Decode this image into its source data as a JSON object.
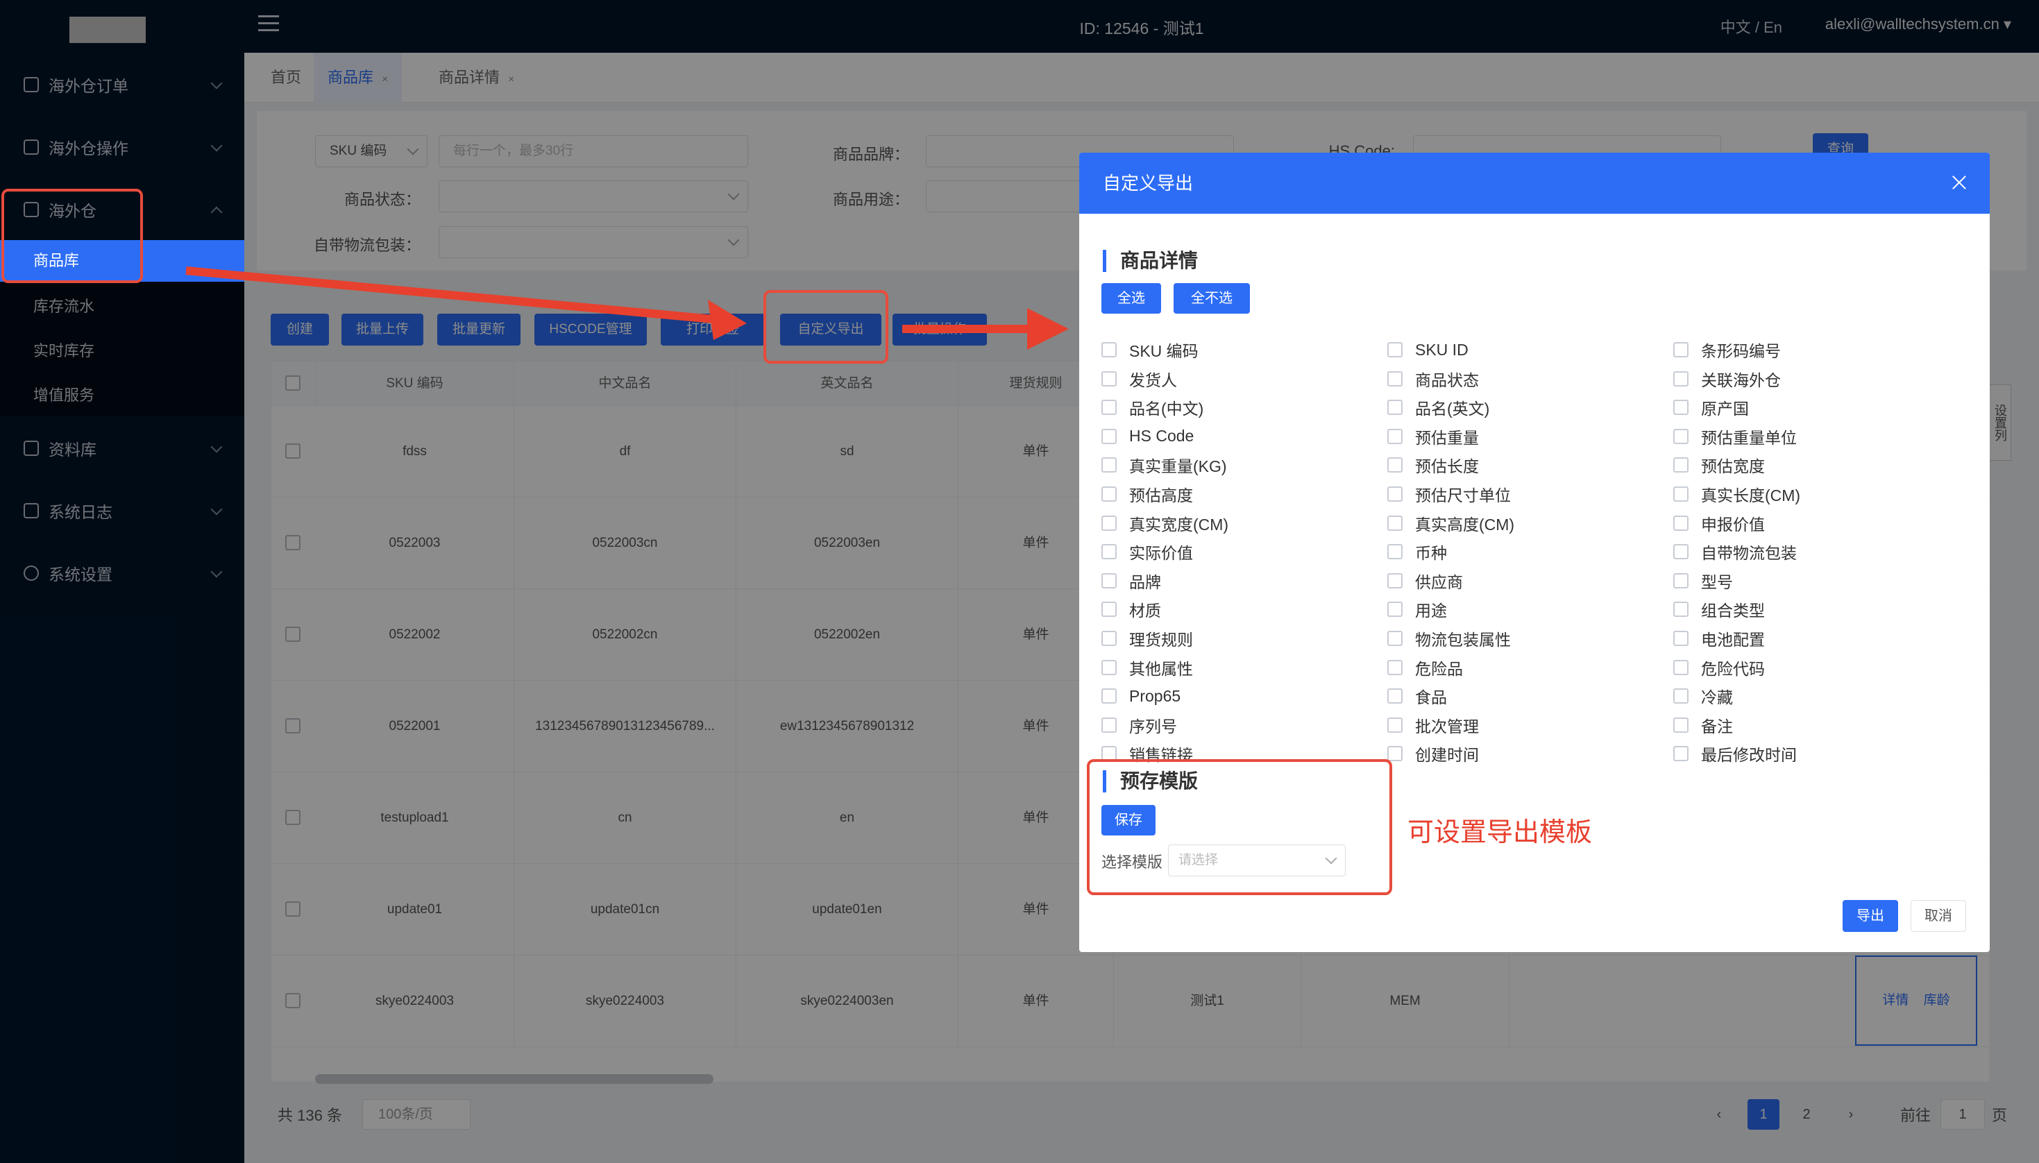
{
  "header": {
    "id_label": "ID: 12546 - 测试1",
    "lang": "中文 / En",
    "user": "alexli@walltechsystem.cn ▾"
  },
  "sidebar": {
    "items": [
      {
        "label": "海外仓订单"
      },
      {
        "label": "海外仓操作"
      },
      {
        "label": "海外仓"
      },
      {
        "label": "资料库"
      },
      {
        "label": "系统日志"
      },
      {
        "label": "系统设置"
      }
    ],
    "subitems": [
      {
        "label": "商品库"
      },
      {
        "label": "库存流水"
      },
      {
        "label": "实时库存"
      },
      {
        "label": "增值服务"
      }
    ]
  },
  "tabs": [
    {
      "label": "首页"
    },
    {
      "label": "商品库"
    },
    {
      "label": "商品详情"
    }
  ],
  "filter": {
    "sku_select": "SKU 编码",
    "sku_placeholder": "每行一个，最多30行",
    "brand_label": "商品品牌：",
    "hs_label": "HS Code:",
    "status_label": "商品状态：",
    "usage_label": "商品用途：",
    "pack_label": "自带物流包装：",
    "query_btn": "查询"
  },
  "toolbar": {
    "create": "创建",
    "bulk_upload": "批量上传",
    "bulk_update": "批量更新",
    "hscode": "HSCODE管理",
    "print": "打印标签",
    "custom_export": "自定义导出",
    "more": "批量操作"
  },
  "table": {
    "headers": [
      "SKU 编码",
      "中文品名",
      "英文品名",
      "理货规则"
    ],
    "rows": [
      {
        "sku": "fdss",
        "cn": "df",
        "en": "sd",
        "rule": "单件"
      },
      {
        "sku": "0522003",
        "cn": "0522003cn",
        "en": "0522003en",
        "rule": "单件"
      },
      {
        "sku": "0522002",
        "cn": "0522002cn",
        "en": "0522002en",
        "rule": "单件"
      },
      {
        "sku": "0522001",
        "cn": "13123456789013123456789...",
        "en": "ew1312345678901312",
        "rule": "单件"
      },
      {
        "sku": "testupload1",
        "cn": "cn",
        "en": "en",
        "rule": "单件"
      },
      {
        "sku": "update01",
        "cn": "update01cn",
        "en": "update01en",
        "rule": "单件"
      },
      {
        "sku": "skye0224003",
        "cn": "skye0224003",
        "en": "skye0224003en",
        "rule": "单件",
        "extra1": "测试1",
        "extra2": "MEM"
      }
    ],
    "op_detail": "详情",
    "op_stock": "库龄",
    "set_columns": "设置列"
  },
  "pagination": {
    "total": "共 136 条",
    "page_size": "100条/页",
    "pages": [
      "1",
      "2"
    ],
    "prev": "‹",
    "next": "›",
    "goto": "前往",
    "goto_value": "1",
    "page_unit": "页"
  },
  "modal": {
    "title": "自定义导出",
    "section1": "商品详情",
    "select_all": "全选",
    "select_none": "全不选",
    "col1": [
      "SKU 编码",
      "发货人",
      "品名(中文)",
      "HS Code",
      "真实重量(KG)",
      "预估高度",
      "真实宽度(CM)",
      "实际价值",
      "品牌",
      "材质",
      "理货规则",
      "其他属性",
      "Prop65",
      "序列号",
      "销售链接"
    ],
    "col2": [
      "SKU ID",
      "商品状态",
      "品名(英文)",
      "预估重量",
      "预估长度",
      "预估尺寸单位",
      "真实高度(CM)",
      "币种",
      "供应商",
      "用途",
      "物流包装属性",
      "危险品",
      "食品",
      "批次管理",
      "创建时间"
    ],
    "col3": [
      "条形码编号",
      "关联海外仓",
      "原产国",
      "预估重量单位",
      "预估宽度",
      "真实长度(CM)",
      "申报价值",
      "自带物流包装",
      "型号",
      "组合类型",
      "电池配置",
      "危险代码",
      "冷藏",
      "备注",
      "最后修改时间"
    ],
    "section2": "预存模版",
    "save": "保存",
    "tpl_label": "选择模版",
    "tpl_placeholder": "请选择",
    "ok": "导出",
    "cancel": "取消"
  },
  "annotation": "可设置导出模板",
  "colors": {
    "primary": "#2d6df6",
    "sidebar": "#001529",
    "annotation": "#e8402e"
  }
}
